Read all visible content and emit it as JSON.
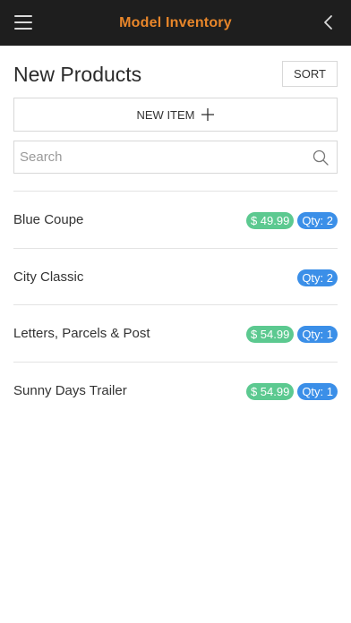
{
  "topbar": {
    "title": "Model Inventory",
    "title_color": "#e8862a",
    "menu_icon": "hamburger-menu-icon",
    "back_icon": "chevron-left-icon"
  },
  "page": {
    "title": "New Products",
    "sort_label": "SORT",
    "new_item_label": "NEW ITEM",
    "new_item_icon": "plus-icon"
  },
  "search": {
    "placeholder": "Search",
    "value": "",
    "icon": "search-icon"
  },
  "colors": {
    "price_badge": "#5cc990",
    "qty_badge": "#3b8fe8"
  },
  "products": [
    {
      "name": "Blue Coupe",
      "price": "$ 49.99",
      "qty": "Qty: 2"
    },
    {
      "name": "City Classic",
      "price": "",
      "qty": "Qty: 2"
    },
    {
      "name": "Letters, Parcels & Post",
      "price": "$ 54.99",
      "qty": "Qty: 1"
    },
    {
      "name": "Sunny Days Trailer",
      "price": "$ 54.99",
      "qty": "Qty: 1"
    }
  ]
}
